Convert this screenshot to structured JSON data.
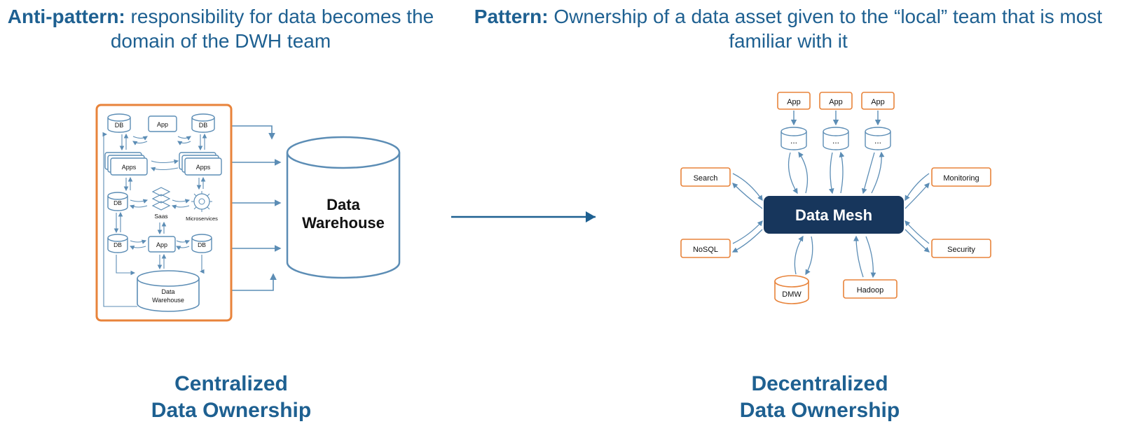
{
  "colors": {
    "blue": "#1e6091",
    "orange": "#e8833a",
    "navy": "#17365c",
    "line": "#5c8db5"
  },
  "left": {
    "heading_label": "Anti-pattern:",
    "heading_rest": " responsibility for data becomes the domain of the DWH team",
    "caption_line1": "Centralized",
    "caption_line2": "Data Ownership",
    "big_cylinder_line1": "Data",
    "big_cylinder_line2": "Warehouse",
    "sources": {
      "db": "DB",
      "app": "App",
      "apps": "Apps",
      "saas": "Saas",
      "microservices": "Microservices",
      "dwh_line1": "Data",
      "dwh_line2": "Warehouse"
    }
  },
  "right": {
    "heading_label": "Pattern:",
    "heading_rest": " Ownership of a data asset given to the “local” team that is most familiar with it",
    "caption_line1": "Decentralized",
    "caption_line2": "Data Ownership",
    "center": "Data Mesh",
    "nodes": {
      "app_top": "App",
      "ellipsis": "...",
      "search": "Search",
      "nosql": "NoSQL",
      "monitoring": "Monitoring",
      "security": "Security",
      "dmw": "DMW",
      "hadoop": "Hadoop"
    }
  }
}
